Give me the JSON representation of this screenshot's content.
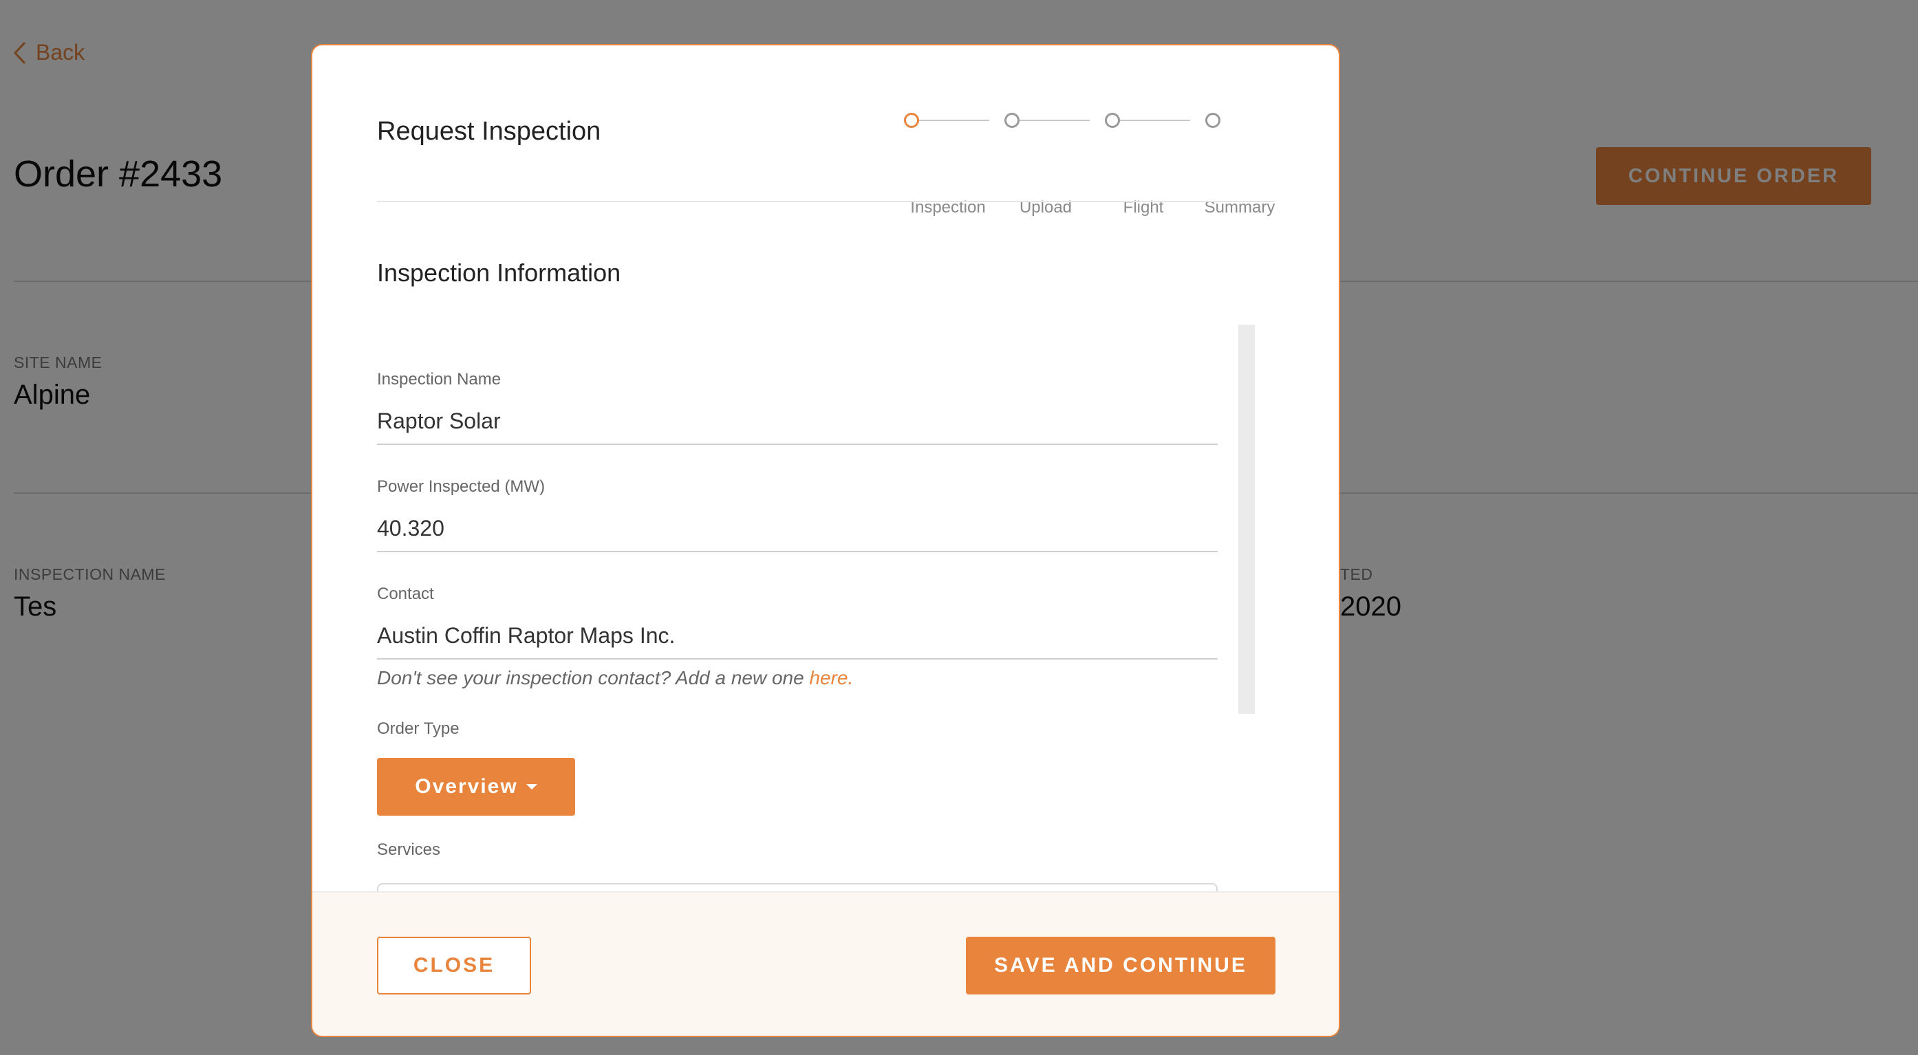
{
  "background": {
    "back_label": "Back",
    "order_title": "Order #2433",
    "continue_order_label": "CONTINUE ORDER",
    "site_name_label": "SITE NAME",
    "site_name_value": "Alpine",
    "inspection_name_label": "INSPECTION NAME",
    "inspection_name_value": "Tes",
    "right_label_partial": "TED",
    "right_value_partial": "2020"
  },
  "modal": {
    "title": "Request Inspection",
    "steps": [
      {
        "label": "Inspection",
        "active": true
      },
      {
        "label": "Upload",
        "active": false
      },
      {
        "label": "Flight",
        "active": false
      },
      {
        "label": "Summary",
        "active": false
      }
    ],
    "section_title": "Inspection Information",
    "fields": {
      "inspection_name": {
        "label": "Inspection Name",
        "value": "Raptor Solar"
      },
      "power_inspected": {
        "label": "Power Inspected (MW)",
        "value": "40.320"
      },
      "contact": {
        "label": "Contact",
        "value": "Austin Coffin Raptor Maps Inc."
      }
    },
    "contact_hint": "Don't see your inspection contact? Add a new one",
    "contact_hint_link": "here.",
    "order_type_label": "Order Type",
    "order_type_value": "Overview",
    "services_label": "Services",
    "close_label": "CLOSE",
    "save_label": "SAVE AND CONTINUE"
  },
  "colors": {
    "accent": "#e8843c",
    "overlay": "rgba(0,0,0,0.5)",
    "footer_bg": "#fdf7f1"
  }
}
